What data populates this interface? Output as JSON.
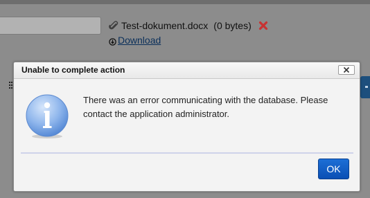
{
  "background": {
    "attachment": {
      "file_name": "Test-dokument.docx",
      "file_size": "(0 bytes)",
      "download_label": "Download",
      "icons": {
        "attachment": "paperclip-icon",
        "remove": "red-x-icon",
        "download": "circle-down-arrow-icon"
      }
    }
  },
  "dialog": {
    "title": "Unable to complete action",
    "message": "There was an error communicating with the database. Please contact the application administrator.",
    "ok_label": "OK",
    "icon": "info-icon",
    "close_icon": "close-x-icon"
  },
  "colors": {
    "overlay": "#8c8c8c",
    "ok_button": "#1560c8",
    "remove_icon": "#c83232",
    "link": "#0a2f5a"
  }
}
